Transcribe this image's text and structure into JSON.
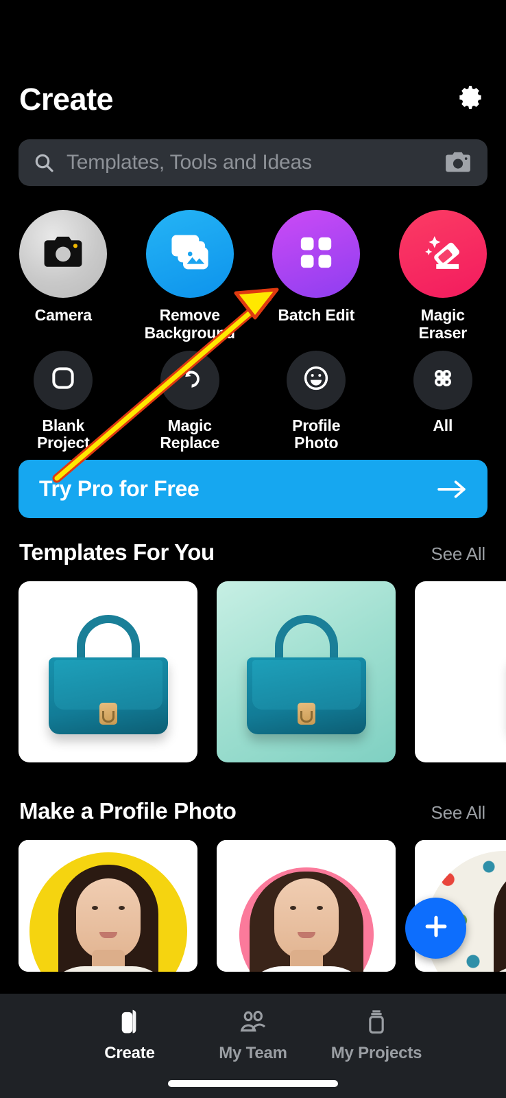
{
  "header": {
    "title": "Create",
    "settings_icon": "gear-icon"
  },
  "search": {
    "placeholder": "Templates, Tools and Ideas",
    "value": "",
    "leading_icon": "search-icon",
    "trailing_icon": "camera-icon"
  },
  "tools": {
    "row1": [
      {
        "label": "Camera",
        "icon": "camera-icon",
        "circle_class": "c-camera",
        "color": "#c9c9c9"
      },
      {
        "label": "Remove Background",
        "icon": "photos-stack-icon",
        "circle_class": "c-remove",
        "color": "#0d93ec"
      },
      {
        "label": "Batch Edit",
        "icon": "grid-four-squares-icon",
        "circle_class": "c-batch",
        "color": "#a03ef0"
      },
      {
        "label": "Magic Eraser",
        "icon": "eraser-sparkle-icon",
        "circle_class": "c-eraser",
        "color": "#f31b5e"
      }
    ],
    "row2": [
      {
        "label": "Blank Project",
        "icon": "rounded-square-outline-icon",
        "color": "#24272c"
      },
      {
        "label": "Magic Replace",
        "icon": "magic-replace-sparkle-icon",
        "color": "#24272c"
      },
      {
        "label": "Profile Photo",
        "icon": "smiley-face-icon",
        "color": "#24272c"
      },
      {
        "label": "All",
        "icon": "four-petal-grid-icon",
        "color": "#24272c"
      }
    ]
  },
  "pro_banner": {
    "label": "Try Pro for Free",
    "arrow_icon": "arrow-right-icon",
    "background_color": "#16a7f0"
  },
  "sections": [
    {
      "title": "Templates For You",
      "see_all": "See All",
      "cards": [
        {
          "name": "handbag-on-white",
          "style": "card-white"
        },
        {
          "name": "handbag-on-mint-gradient",
          "style": "card-mint"
        },
        {
          "name": "handbag-on-white-partial",
          "style": "card-white"
        }
      ]
    },
    {
      "title": "Make a Profile Photo",
      "see_all": "See All",
      "cards": [
        {
          "name": "portrait-yellow-circle",
          "style": "pbg-yellow"
        },
        {
          "name": "portrait-pink-circle",
          "style": "pbg-pink"
        },
        {
          "name": "portrait-confetti-dots",
          "style": "pbg-dots"
        }
      ]
    }
  ],
  "fab": {
    "icon": "plus-icon",
    "color": "#0d6efd"
  },
  "bottom_nav": {
    "items": [
      {
        "label": "Create",
        "icon": "cards-stack-icon",
        "active": true
      },
      {
        "label": "My Team",
        "icon": "people-icon",
        "active": false
      },
      {
        "label": "My Projects",
        "icon": "box-icon",
        "active": false
      }
    ]
  },
  "annotation": {
    "type": "arrow",
    "fill_color": "#ffe800",
    "stroke_color": "#e03a10",
    "points_to": "Batch Edit"
  }
}
